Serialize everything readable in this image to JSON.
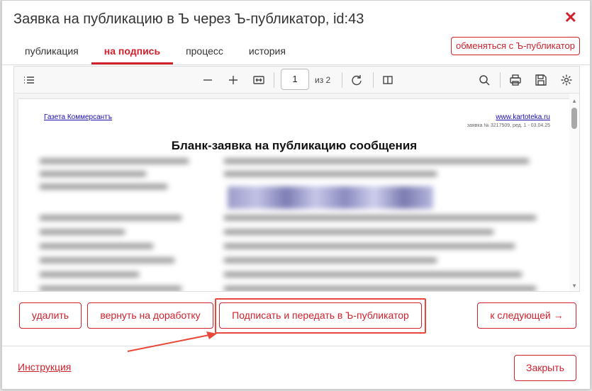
{
  "dialog": {
    "title": "Заявка на публикацию в Ъ через Ъ-публикатор, id:43",
    "close_icon": "close-icon",
    "exchange_button": "обменяться с Ъ-публикатор"
  },
  "tabs": [
    {
      "label": "публикация",
      "active": false
    },
    {
      "label": "на подпись",
      "active": true
    },
    {
      "label": "процесс",
      "active": false
    },
    {
      "label": "история",
      "active": false
    }
  ],
  "viewer": {
    "page_number": "1",
    "page_of": "из 2",
    "icons": [
      "list-icon",
      "zoom-out-icon",
      "zoom-in-icon",
      "fit-width-icon",
      "rotate-icon",
      "page-view-icon",
      "search-icon",
      "print-icon",
      "save-icon",
      "settings-icon"
    ]
  },
  "document": {
    "left_header": "Газета Коммерсантъ",
    "right_header": "www.kartoteka.ru",
    "reference": "заявка № 3217509, ред. 1 - 03.04.25",
    "heading": "Бланк-заявка на публикацию сообщения"
  },
  "actions": {
    "delete": "удалить",
    "return": "вернуть на доработку",
    "sign": "Подписать и передать в Ъ-публикатор",
    "next": "к следующей →"
  },
  "footer": {
    "instruction": "Инструкция",
    "close": "Закрыть"
  },
  "colors": {
    "accent": "#d0212d",
    "annotation": "#e8473b"
  }
}
